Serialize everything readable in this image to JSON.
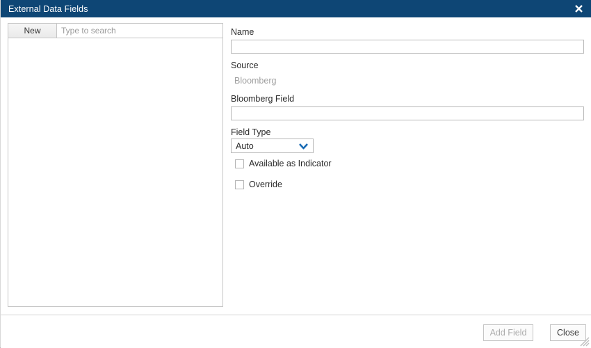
{
  "window": {
    "title": "External Data Fields",
    "close_icon": "close-x-icon",
    "accent_color": "#0e4675",
    "title_color": "#ffffff"
  },
  "left_panel": {
    "new_button_label": "New",
    "search_placeholder": "Type to search",
    "search_value": "",
    "list_items": []
  },
  "form": {
    "name": {
      "label": "Name",
      "value": "",
      "placeholder": ""
    },
    "source": {
      "label": "Source",
      "value": "Bloomberg"
    },
    "bloomberg_field": {
      "label": "Bloomberg Field",
      "value": "",
      "placeholder": ""
    },
    "field_type": {
      "label": "Field Type",
      "selected": "Auto",
      "options": [
        "Auto"
      ],
      "arrow_icon": "chevron-down-icon",
      "arrow_color": "#1a6cb5"
    },
    "available_as_indicator": {
      "label": "Available as Indicator",
      "checked": false
    },
    "override": {
      "label": "Override",
      "checked": false
    }
  },
  "footer": {
    "add_field_label": "Add Field",
    "add_field_enabled": false,
    "close_label": "Close",
    "close_enabled": true,
    "resize_grip_icon": "resize-grip-icon"
  }
}
